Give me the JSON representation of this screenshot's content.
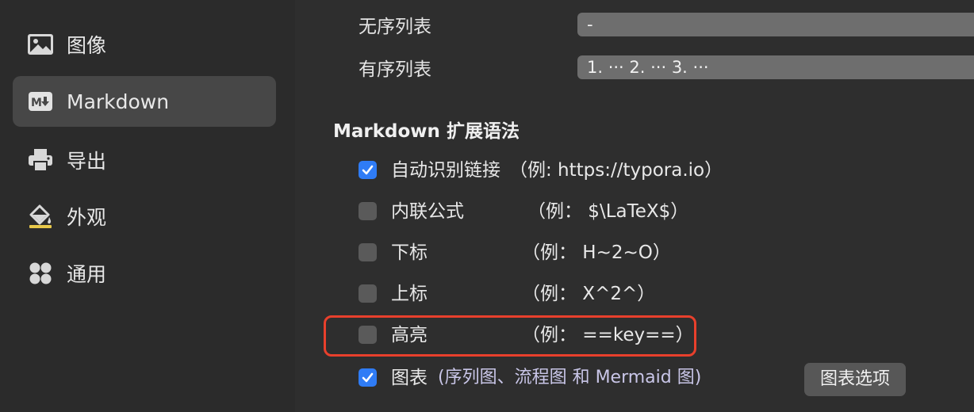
{
  "sidebar": {
    "items": [
      {
        "label": "图像",
        "icon": "image-icon",
        "active": false
      },
      {
        "label": "Markdown",
        "icon": "markdown-icon",
        "active": true
      },
      {
        "label": "导出",
        "icon": "printer-icon",
        "active": false
      },
      {
        "label": "外观",
        "icon": "paint-bucket-icon",
        "active": false
      },
      {
        "label": "通用",
        "icon": "grid-icon",
        "active": false
      }
    ]
  },
  "lists": {
    "unordered_label": "无序列表",
    "unordered_value": "-",
    "ordered_label": "有序列表",
    "ordered_value": "1. ··· 2. ··· 3. ···"
  },
  "extensions": {
    "heading": "Markdown 扩展语法",
    "options": [
      {
        "label": "自动识别链接",
        "example": "（例: https://typora.io）",
        "checked": true
      },
      {
        "label": "内联公式",
        "example": "（例：  $\\LaTeX$）",
        "checked": false
      },
      {
        "label": "下标",
        "example": "（例：  H~2~O）",
        "checked": false
      },
      {
        "label": "上标",
        "example": "（例：  X^2^）",
        "checked": false
      },
      {
        "label": "高亮",
        "example": "（例：  ==key==）",
        "checked": false
      },
      {
        "label": "图表",
        "example": "(序列图、流程图 和 Mermaid 图)",
        "checked": true
      }
    ],
    "chart_options_button": "图表选项"
  },
  "colors": {
    "accent": "#2f7cf6",
    "highlight_frame": "#e8402c",
    "sidebar_active": "#474747"
  }
}
